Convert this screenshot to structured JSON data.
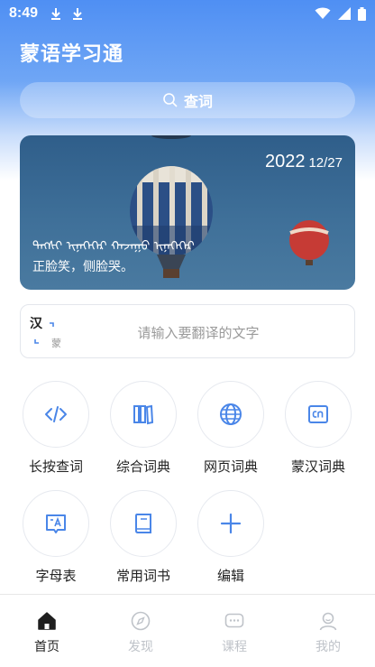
{
  "status_bar": {
    "time": "8:49"
  },
  "app": {
    "title": "蒙语学习通"
  },
  "search": {
    "label": "查词"
  },
  "banner": {
    "year": "2022",
    "month_day": "12/27",
    "mongolian_text": "ᠲᠡᠭᠰᠢ ᠢᠨᠡᠭᠡᠭᠡᠷ ᠬᠠᠵᠠᠭᠤ ᠢᠨᠡᠭᠡᠭᠡᠷ",
    "quote": "正脸笑，侧脸哭。"
  },
  "translate": {
    "source_lang": "汉",
    "target_lang": "蒙",
    "placeholder": "请输入要翻译的文字"
  },
  "features": [
    {
      "label": "长按查词",
      "icon": "code-icon"
    },
    {
      "label": "综合词典",
      "icon": "books-icon"
    },
    {
      "label": "网页词典",
      "icon": "globe-icon"
    },
    {
      "label": "蒙汉词典",
      "icon": "cn-icon"
    },
    {
      "label": "字母表",
      "icon": "alphabet-icon"
    },
    {
      "label": "常用词书",
      "icon": "book-icon"
    },
    {
      "label": "编辑",
      "icon": "plus-icon"
    }
  ],
  "nav": [
    {
      "label": "首页",
      "icon": "home-icon",
      "active": true
    },
    {
      "label": "发现",
      "icon": "compass-icon"
    },
    {
      "label": "课程",
      "icon": "chat-icon"
    },
    {
      "label": "我的",
      "icon": "profile-icon"
    }
  ],
  "colors": {
    "accent": "#4f8ff3",
    "icon_blue": "#4a86e8",
    "inactive": "#bfc3c9"
  }
}
